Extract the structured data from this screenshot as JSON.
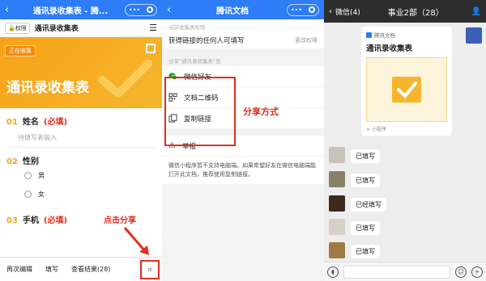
{
  "panel1": {
    "titlebar": "通讯录收集表 - 腾...",
    "subhead": {
      "perm_label": "权限",
      "doc_name": "通讯录收集表"
    },
    "banner": {
      "tag": "正在收集",
      "title": "通讯录收集表"
    },
    "questions": [
      {
        "num": "01",
        "label": "姓名",
        "required": "(必填)",
        "placeholder": "待填写者输入"
      },
      {
        "num": "02",
        "label": "性别",
        "options": [
          "男",
          "女"
        ]
      },
      {
        "num": "03",
        "label": "手机",
        "required": "(必填)"
      }
    ],
    "bottombar": {
      "reedit": "再次编辑",
      "fill": "填写",
      "results": "查看结果(28)"
    },
    "annotation": "点击分享"
  },
  "panel2": {
    "titlebar": "腾讯文档",
    "permission_section_label": "当前收集表权限",
    "permission_value": "获得链接的任何人可填写",
    "permission_change": "更改权限",
    "share_section_label": "分享\"通讯录收集表\"至",
    "share_items": [
      "微信好友",
      "文档二维码",
      "复制链接"
    ],
    "report": "举报",
    "annotation": "分享方式",
    "note": "微信小程序暂不支持电脑端。如果希望好友在微信电脑端能打开此文档，推荐使用复制链接。"
  },
  "panel3": {
    "back_label": "微信(4)",
    "chat_title": "事业2部（28）",
    "card": {
      "source": "腾讯文档",
      "title": "通讯录收集表",
      "mini_label": "小程序"
    },
    "messages": [
      "已填写",
      "已填写",
      "已经填写",
      "已填写",
      "已填写"
    ]
  },
  "colors": {
    "accent_blue": "#2e7cf6",
    "orange": "#f7a318",
    "red": "#e0301e"
  }
}
